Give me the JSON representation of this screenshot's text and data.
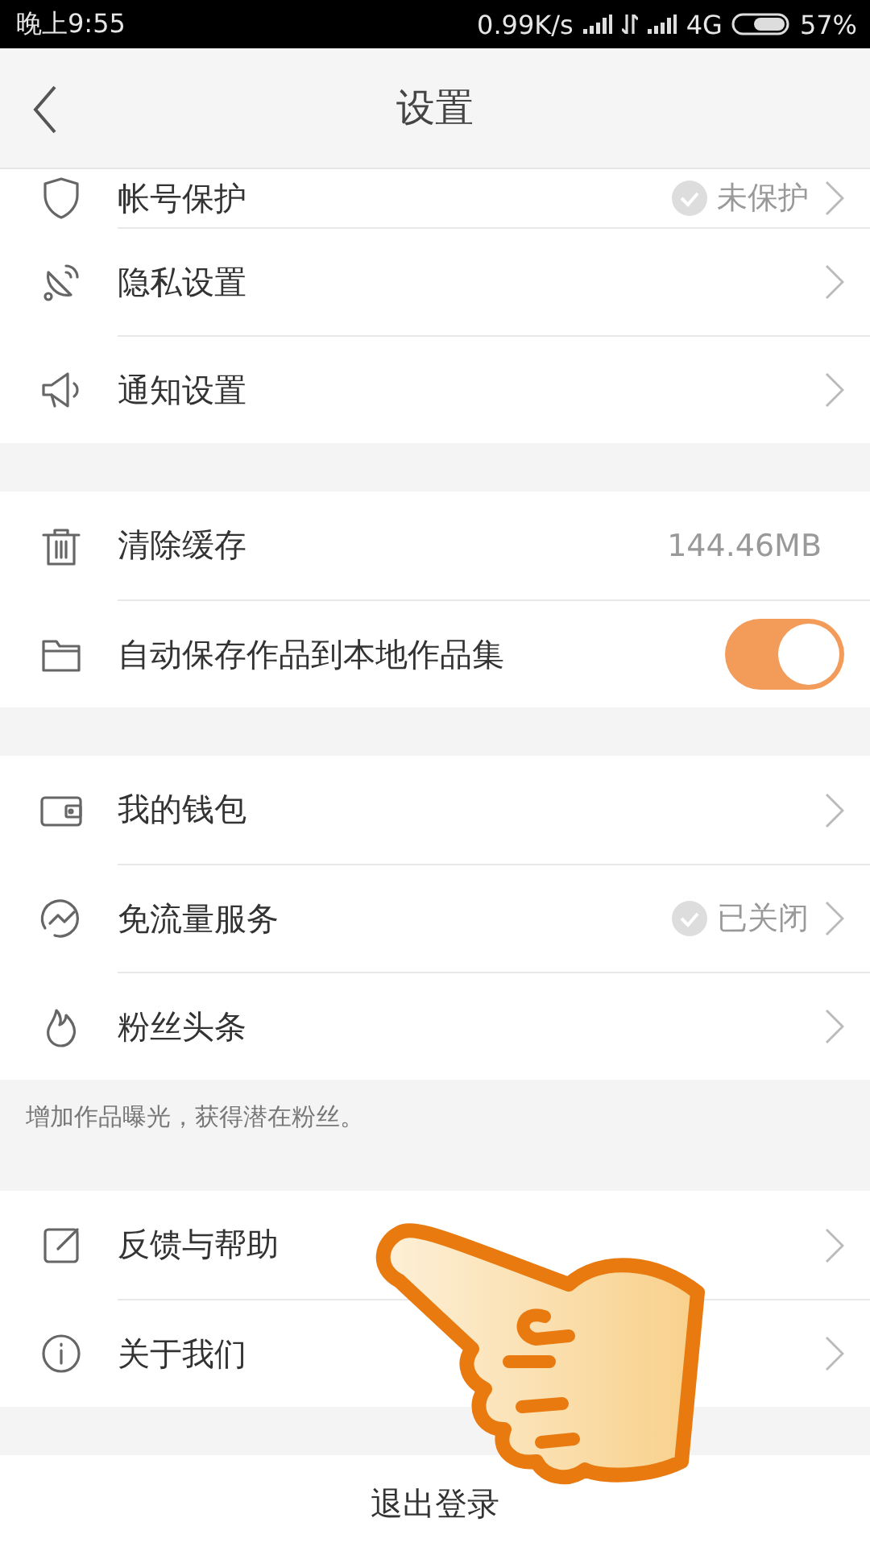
{
  "status_bar": {
    "time": "晚上9:55",
    "speed": "0.99K/s",
    "network": "4G",
    "battery": "57%"
  },
  "header": {
    "title": "设置"
  },
  "groups": [
    {
      "items": [
        {
          "kind": "status",
          "label": "帐号保护",
          "value": "未保护"
        },
        {
          "kind": "link",
          "label": "隐私设置"
        },
        {
          "kind": "link",
          "label": "通知设置"
        }
      ]
    },
    {
      "items": [
        {
          "kind": "value",
          "label": "清除缓存",
          "value": "144.46MB"
        },
        {
          "kind": "toggle",
          "label": "自动保存作品到本地作品集",
          "on": true
        }
      ]
    },
    {
      "items": [
        {
          "kind": "link",
          "label": "我的钱包"
        },
        {
          "kind": "status",
          "label": "免流量服务",
          "value": "已关闭"
        },
        {
          "kind": "link",
          "label": "粉丝头条"
        }
      ],
      "note": "增加作品曝光，获得潜在粉丝。"
    },
    {
      "items": [
        {
          "kind": "link",
          "label": "反馈与帮助"
        },
        {
          "kind": "link",
          "label": "关于我们"
        }
      ]
    }
  ],
  "logout": "退出登录"
}
